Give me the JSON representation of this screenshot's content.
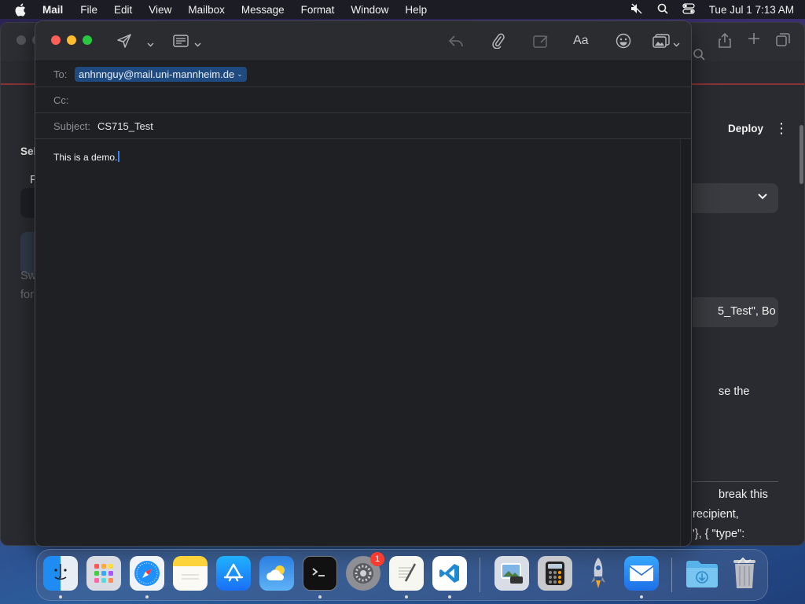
{
  "menubar": {
    "app": "Mail",
    "items": [
      "File",
      "Edit",
      "View",
      "Mailbox",
      "Message",
      "Format",
      "Window",
      "Help"
    ],
    "clock": "Tue Jul 1  7:13 AM",
    "status_icons": [
      "mute-icon",
      "search-icon",
      "control-center-icon"
    ]
  },
  "background_window": {
    "deploy_label": "Deploy",
    "peek_left": [
      "Sel",
      "F",
      "Sw",
      "for"
    ],
    "text_right": {
      "pill": "5_Test\", Bo",
      "use_the": "se the",
      "break_this": "break this",
      "recipient": "recipient,",
      "type_line": "'}, { \"type\":"
    }
  },
  "compose": {
    "to_label": "To:",
    "to_value": "anhnnguy@mail.uni-mannheim.de",
    "cc_label": "Cc:",
    "cc_value": "",
    "subject_label": "Subject:",
    "subject_value": "CS715_Test",
    "body": "This is a demo.",
    "toolbar": {
      "format_label": "Aa",
      "icons": [
        "send-icon",
        "chevron-down-icon",
        "header-fields-icon",
        "reply-icon",
        "attachment-icon",
        "markup-icon",
        "format-icon",
        "emoji-icon",
        "photo-browser-icon"
      ]
    }
  },
  "dock": {
    "apps": [
      "Finder",
      "Launchpad",
      "Safari",
      "Notes",
      "App Store",
      "Weather",
      "Terminal",
      "System Settings",
      "TextEdit",
      "Visual Studio Code",
      "Preview",
      "Calculator",
      "Rocket",
      "Mail",
      "Downloads",
      "Trash"
    ],
    "settings_badge": "1"
  },
  "colors": {
    "accent": "#3b82f6",
    "token_bg": "#1f4a80",
    "close": "#fe5f57",
    "minimize": "#febc2e",
    "zoom": "#28c840"
  }
}
